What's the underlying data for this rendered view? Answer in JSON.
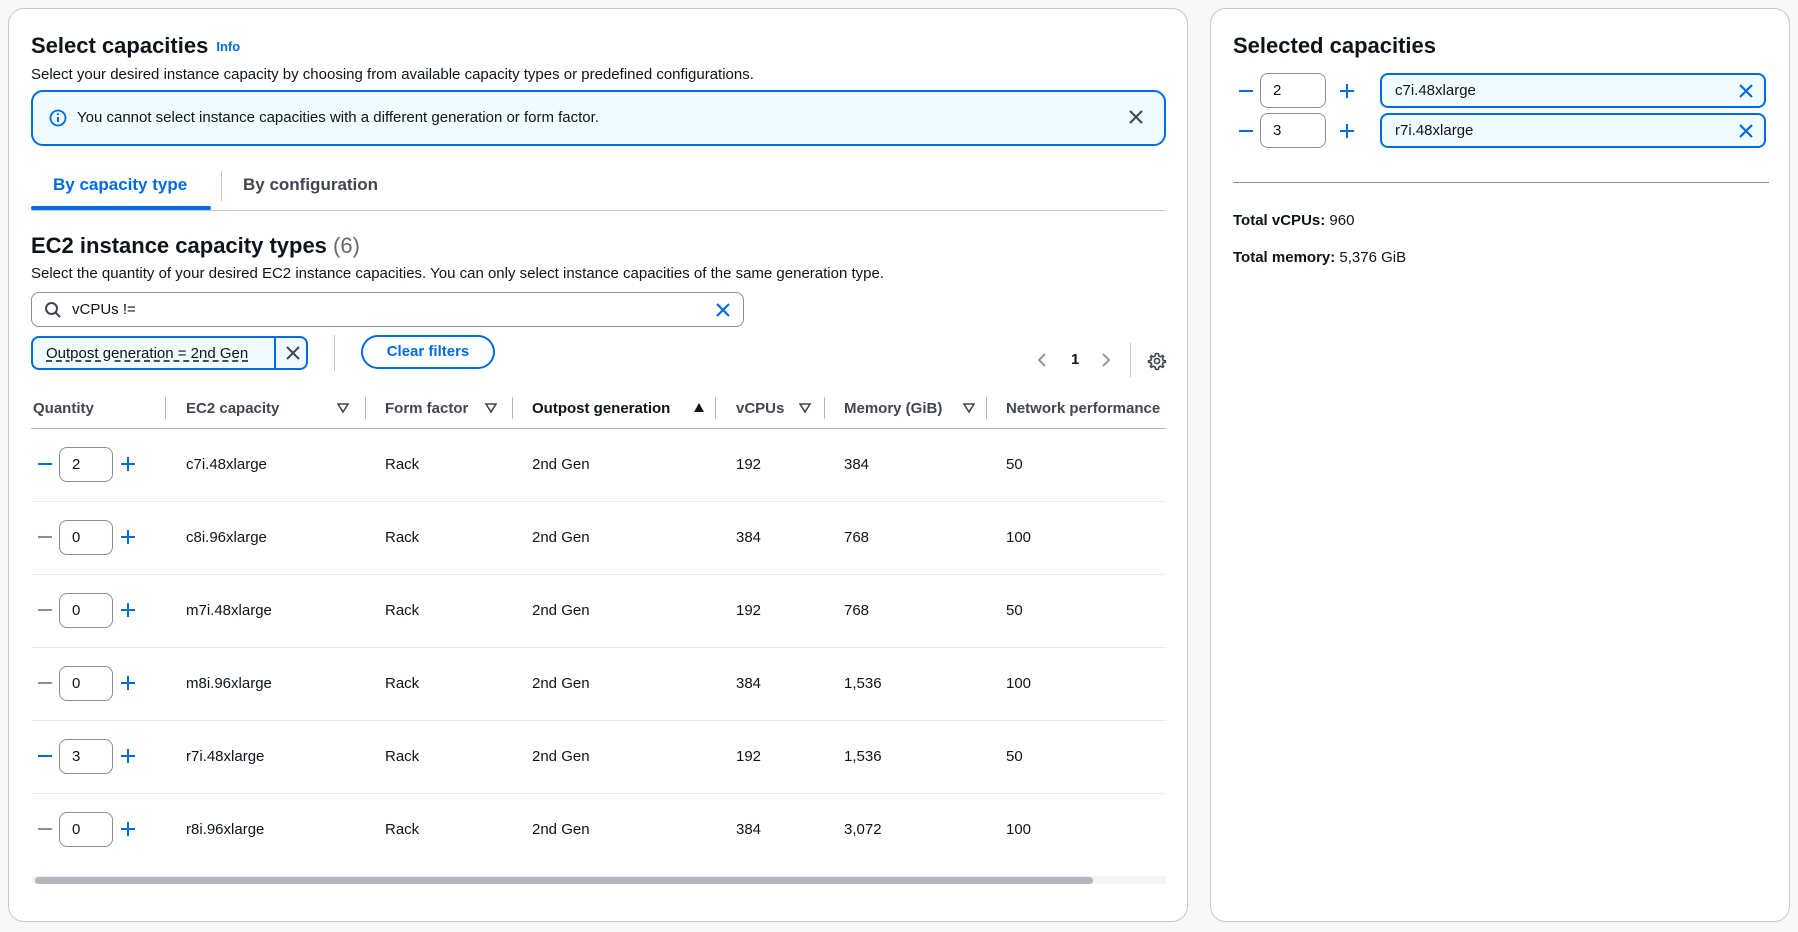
{
  "left": {
    "title": "Select capacities",
    "info_label": "Info",
    "description": "Select your desired instance capacity by choosing from available capacity types or predefined configurations.",
    "alert": {
      "text": "You cannot select instance capacities with a different generation or form factor.",
      "icon": "info-icon"
    },
    "tabs": [
      {
        "label": "By capacity type",
        "active": true
      },
      {
        "label": "By configuration",
        "active": false
      }
    ],
    "section": {
      "title": "EC2 instance capacity types",
      "count": "(6)",
      "description": "Select the quantity of your desired EC2 instance capacities. You can only select instance capacities of the same generation type."
    },
    "search": {
      "value": "vCPUs !="
    },
    "filter_token": "Outpost generation = 2nd Gen",
    "clear_filters_label": "Clear filters",
    "pagination": {
      "current_page": "1"
    },
    "table": {
      "columns": [
        "Quantity",
        "EC2 capacity",
        "Form factor",
        "Outpost generation",
        "vCPUs",
        "Memory (GiB)",
        "Network performance"
      ],
      "sorted_column": "Outpost generation",
      "rows": [
        {
          "quantity": "2",
          "capacity": "c7i.48xlarge",
          "form_factor": "Rack",
          "generation": "2nd Gen",
          "vcpus": "192",
          "memory": "384",
          "network": "50"
        },
        {
          "quantity": "0",
          "capacity": "c8i.96xlarge",
          "form_factor": "Rack",
          "generation": "2nd Gen",
          "vcpus": "384",
          "memory": "768",
          "network": "100"
        },
        {
          "quantity": "0",
          "capacity": "m7i.48xlarge",
          "form_factor": "Rack",
          "generation": "2nd Gen",
          "vcpus": "192",
          "memory": "768",
          "network": "50"
        },
        {
          "quantity": "0",
          "capacity": "m8i.96xlarge",
          "form_factor": "Rack",
          "generation": "2nd Gen",
          "vcpus": "384",
          "memory": "1,536",
          "network": "100"
        },
        {
          "quantity": "3",
          "capacity": "r7i.48xlarge",
          "form_factor": "Rack",
          "generation": "2nd Gen",
          "vcpus": "192",
          "memory": "1,536",
          "network": "50"
        },
        {
          "quantity": "0",
          "capacity": "r8i.96xlarge",
          "form_factor": "Rack",
          "generation": "2nd Gen",
          "vcpus": "384",
          "memory": "3,072",
          "network": "100"
        }
      ]
    }
  },
  "right": {
    "title": "Selected capacities",
    "selected": [
      {
        "quantity": "2",
        "capacity": "c7i.48xlarge"
      },
      {
        "quantity": "3",
        "capacity": "r7i.48xlarge"
      }
    ],
    "total_vcpus_label": "Total vCPUs:",
    "total_vcpus_value": "960",
    "total_memory_label": "Total memory:",
    "total_memory_value": "5,376 GiB"
  },
  "colors": {
    "accent": "#006ce0",
    "alert_bg": "#f0fbff",
    "border": "#c6c6cd",
    "disabled": "#8c8c94"
  }
}
